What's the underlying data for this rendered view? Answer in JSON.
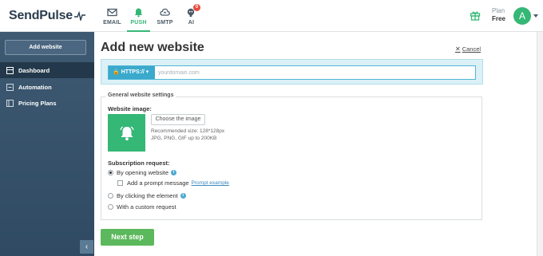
{
  "brand": {
    "name": "SendPulse"
  },
  "nav": {
    "tabs": [
      {
        "label": "EMAIL",
        "icon": "envelope-icon",
        "active": false
      },
      {
        "label": "PUSH",
        "icon": "bell-icon",
        "active": true
      },
      {
        "label": "SMTP",
        "icon": "cloud-icon",
        "active": false
      },
      {
        "label": "AI",
        "icon": "robot-icon",
        "active": false,
        "badge": "0"
      }
    ]
  },
  "header": {
    "gift_icon": "gift-icon",
    "plan_label": "Plan",
    "plan_value": "Free",
    "avatar_initial": "A"
  },
  "sidebar": {
    "add_button": "Add website",
    "items": [
      {
        "label": "Dashboard",
        "icon": "dashboard-icon",
        "active": true
      },
      {
        "label": "Automation",
        "icon": "automation-icon",
        "active": false
      },
      {
        "label": "Pricing Plans",
        "icon": "pricing-icon",
        "active": false
      }
    ],
    "collapse_glyph": "‹"
  },
  "main": {
    "title": "Add new website",
    "cancel_label": "Cancel",
    "protocol": "HTTPS://",
    "url_placeholder": "yourdomain.com",
    "url_value": "",
    "settings_legend": "General website settings",
    "image_label": "Website image:",
    "choose_image": "Choose the image",
    "image_hint_size": "Recommended size: 128*128px",
    "image_hint_formats": "JPG, PNG, GIF up to 200KB",
    "subscription_label": "Subscription request:",
    "option_opening": "By opening website",
    "option_prompt": "Add a prompt message",
    "prompt_example": "Prompt example",
    "option_element": "By clicking the element",
    "option_custom": "With a custom request",
    "next_button": "Next step"
  },
  "colors": {
    "accent_green": "#35b776",
    "sidebar_bg": "#3e5a72",
    "url_panel_bg": "#dbf1f7",
    "protocol_blue": "#3aa9cc",
    "next_button": "#5cb85c"
  }
}
